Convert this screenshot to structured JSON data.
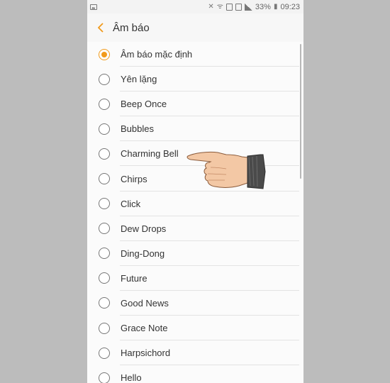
{
  "statusbar": {
    "battery": "33%",
    "time": "09:23"
  },
  "header": {
    "title": "Âm báo"
  },
  "list": {
    "items": [
      {
        "label": "Âm báo mặc định",
        "selected": true
      },
      {
        "label": "Yên lặng",
        "selected": false
      },
      {
        "label": "Beep Once",
        "selected": false
      },
      {
        "label": "Bubbles",
        "selected": false
      },
      {
        "label": "Charming Bell",
        "selected": false
      },
      {
        "label": "Chirps",
        "selected": false
      },
      {
        "label": "Click",
        "selected": false
      },
      {
        "label": "Dew Drops",
        "selected": false
      },
      {
        "label": "Ding-Dong",
        "selected": false
      },
      {
        "label": "Future",
        "selected": false
      },
      {
        "label": "Good News",
        "selected": false
      },
      {
        "label": "Grace Note",
        "selected": false
      },
      {
        "label": "Harpsichord",
        "selected": false
      },
      {
        "label": "Hello",
        "selected": false
      }
    ]
  },
  "colors": {
    "accent": "#f19a1b",
    "background": "#bcbcbc"
  }
}
